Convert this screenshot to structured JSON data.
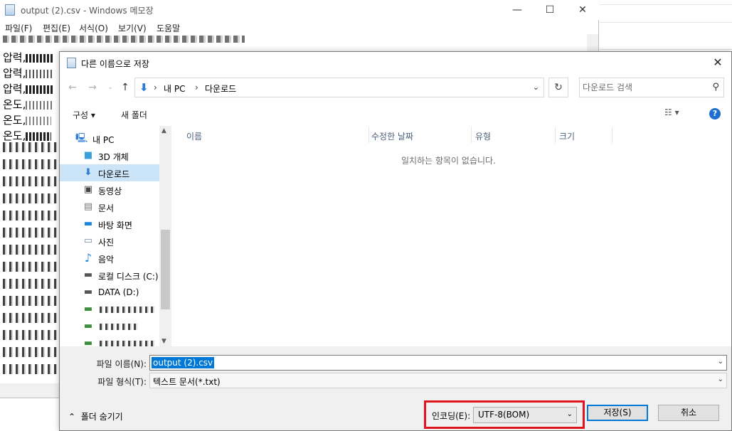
{
  "notepad": {
    "title": "output (2).csv - Windows 메모장",
    "menu": [
      "파일(F)",
      "편집(E)",
      "서식(O)",
      "보기(V)",
      "도움말"
    ],
    "lines": [
      "압력,",
      "압력,",
      "압력,",
      "온도,",
      "온도,",
      "온도,"
    ]
  },
  "dialog": {
    "title": "다른 이름으로 저장",
    "address": {
      "crumbs": [
        "내 PC",
        "다운로드"
      ]
    },
    "search_placeholder": "다운로드 검색",
    "toolbar": {
      "organize": "구성",
      "new_folder": "새 폴더"
    },
    "nav_items": [
      {
        "label": "내 PC",
        "icon": "computer-icon"
      },
      {
        "label": "3D 개체",
        "icon": "cube-icon"
      },
      {
        "label": "다운로드",
        "icon": "download-icon",
        "selected": true
      },
      {
        "label": "동영상",
        "icon": "video-icon"
      },
      {
        "label": "문서",
        "icon": "document-icon"
      },
      {
        "label": "바탕 화면",
        "icon": "desktop-icon"
      },
      {
        "label": "사진",
        "icon": "picture-icon"
      },
      {
        "label": "음악",
        "icon": "music-icon"
      },
      {
        "label": "로컬 디스크 (C:)",
        "icon": "drive-icon"
      },
      {
        "label": "DATA (D:)",
        "icon": "drive-icon"
      }
    ],
    "columns": [
      "이름",
      "수정한 날짜",
      "유형",
      "크기"
    ],
    "empty_message": "일치하는 항목이 없습니다.",
    "file_name_label": "파일 이름(N):",
    "file_name_value": "output (2).csv",
    "file_type_label": "파일 형식(T):",
    "file_type_value": "텍스트 문서(*.txt)",
    "hide_folders": "폴더 숨기기",
    "encoding_label": "인코딩(E):",
    "encoding_value": "UTF-8(BOM)",
    "save_label": "저장(S)",
    "cancel_label": "취소",
    "highlight_color": "#e0151f",
    "accent_color": "#0078d7"
  }
}
